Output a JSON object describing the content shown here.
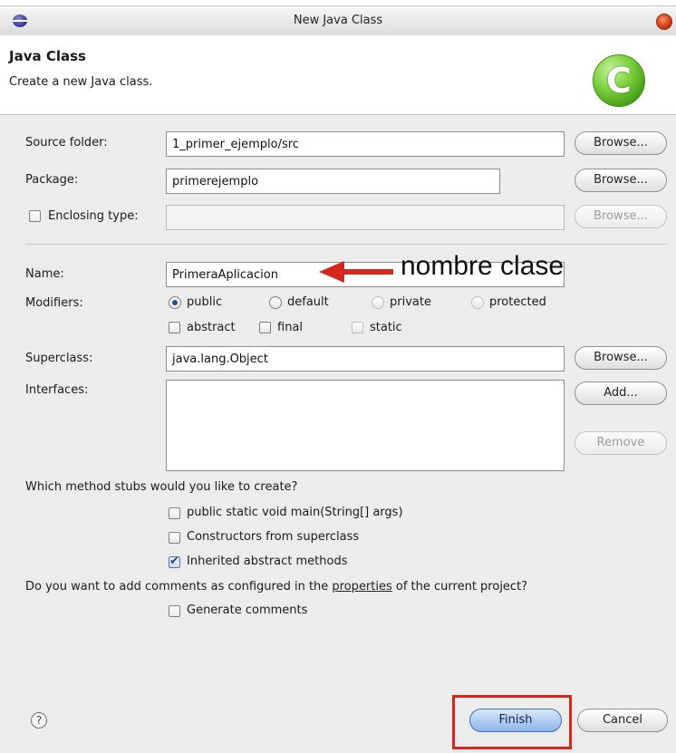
{
  "window": {
    "title": "New Java Class"
  },
  "header": {
    "title": "Java Class",
    "description": "Create a new Java class."
  },
  "form": {
    "source_folder": {
      "label": "Source folder:",
      "value": "1_primer_ejemplo/src",
      "browse": "Browse..."
    },
    "package": {
      "label": "Package:",
      "value": "primerejemplo",
      "browse": "Browse..."
    },
    "enclosing_type": {
      "label": "Enclosing type:",
      "value": "",
      "checked": false,
      "browse": "Browse..."
    },
    "name": {
      "label": "Name:",
      "value": "PrimeraAplicacion"
    },
    "modifiers": {
      "label": "Modifiers:",
      "radios": [
        {
          "label": "public",
          "selected": true,
          "enabled": true
        },
        {
          "label": "default",
          "selected": false,
          "enabled": true
        },
        {
          "label": "private",
          "selected": false,
          "enabled": false
        },
        {
          "label": "protected",
          "selected": false,
          "enabled": false
        }
      ],
      "checks": [
        {
          "label": "abstract",
          "checked": false,
          "enabled": true
        },
        {
          "label": "final",
          "checked": false,
          "enabled": true
        },
        {
          "label": "static",
          "checked": false,
          "enabled": false
        }
      ]
    },
    "superclass": {
      "label": "Superclass:",
      "value": "java.lang.Object",
      "browse": "Browse..."
    },
    "interfaces": {
      "label": "Interfaces:",
      "add": "Add...",
      "remove": "Remove"
    }
  },
  "stubs": {
    "question": "Which method stubs would you like to create?",
    "options": [
      {
        "label": "public static void main(String[] args)",
        "checked": false
      },
      {
        "label": "Constructors from superclass",
        "checked": false
      },
      {
        "label": "Inherited abstract methods",
        "checked": true
      }
    ]
  },
  "comments": {
    "question_before": "Do you want to add comments as configured in the ",
    "question_link": "properties",
    "question_after": " of the current project?",
    "option": {
      "label": "Generate comments",
      "checked": false
    }
  },
  "annotation": {
    "text": "nombre clase"
  },
  "footer": {
    "help": "?",
    "finish": "Finish",
    "cancel": "Cancel"
  },
  "colors": {
    "annotation_red": "#d5271d",
    "finish_blue": "#8fb4ea",
    "logo_green": "#7ed13f"
  }
}
